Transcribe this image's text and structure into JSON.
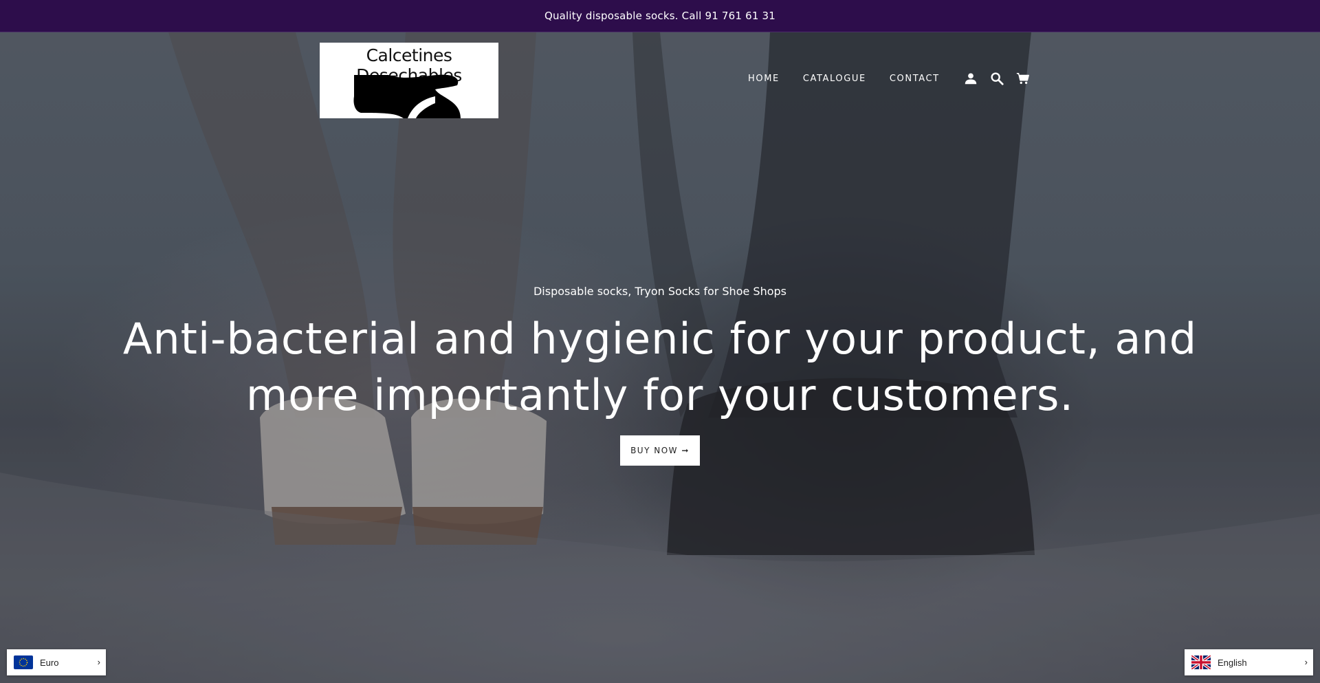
{
  "announcement": "Quality disposable socks. Call 91 761 61 31",
  "logo": {
    "text": "Calcetines Desechables"
  },
  "nav": {
    "links": [
      "HOME",
      "CATALOGUE",
      "CONTACT"
    ],
    "icons": [
      "account-icon",
      "search-icon",
      "cart-icon"
    ]
  },
  "hero": {
    "subheading": "Disposable socks, Tryon Socks for Shoe Shops",
    "headline": "Anti-bacterial and hygienic for your product, and more importantly for your customers.",
    "button_label": "BUY NOW ➞"
  },
  "slideshow": {
    "slide_count": 2,
    "active_slide": 1
  },
  "currency_switcher": {
    "label": "Euro",
    "flag": "eu-flag-icon",
    "chevron": "›"
  },
  "language_switcher": {
    "label": "English",
    "flag": "uk-flag-icon",
    "chevron": "›"
  },
  "colors": {
    "announcement_bg": "#2d0d4b",
    "button_bg": "#ffffff",
    "text_on_hero": "#ffffff"
  }
}
